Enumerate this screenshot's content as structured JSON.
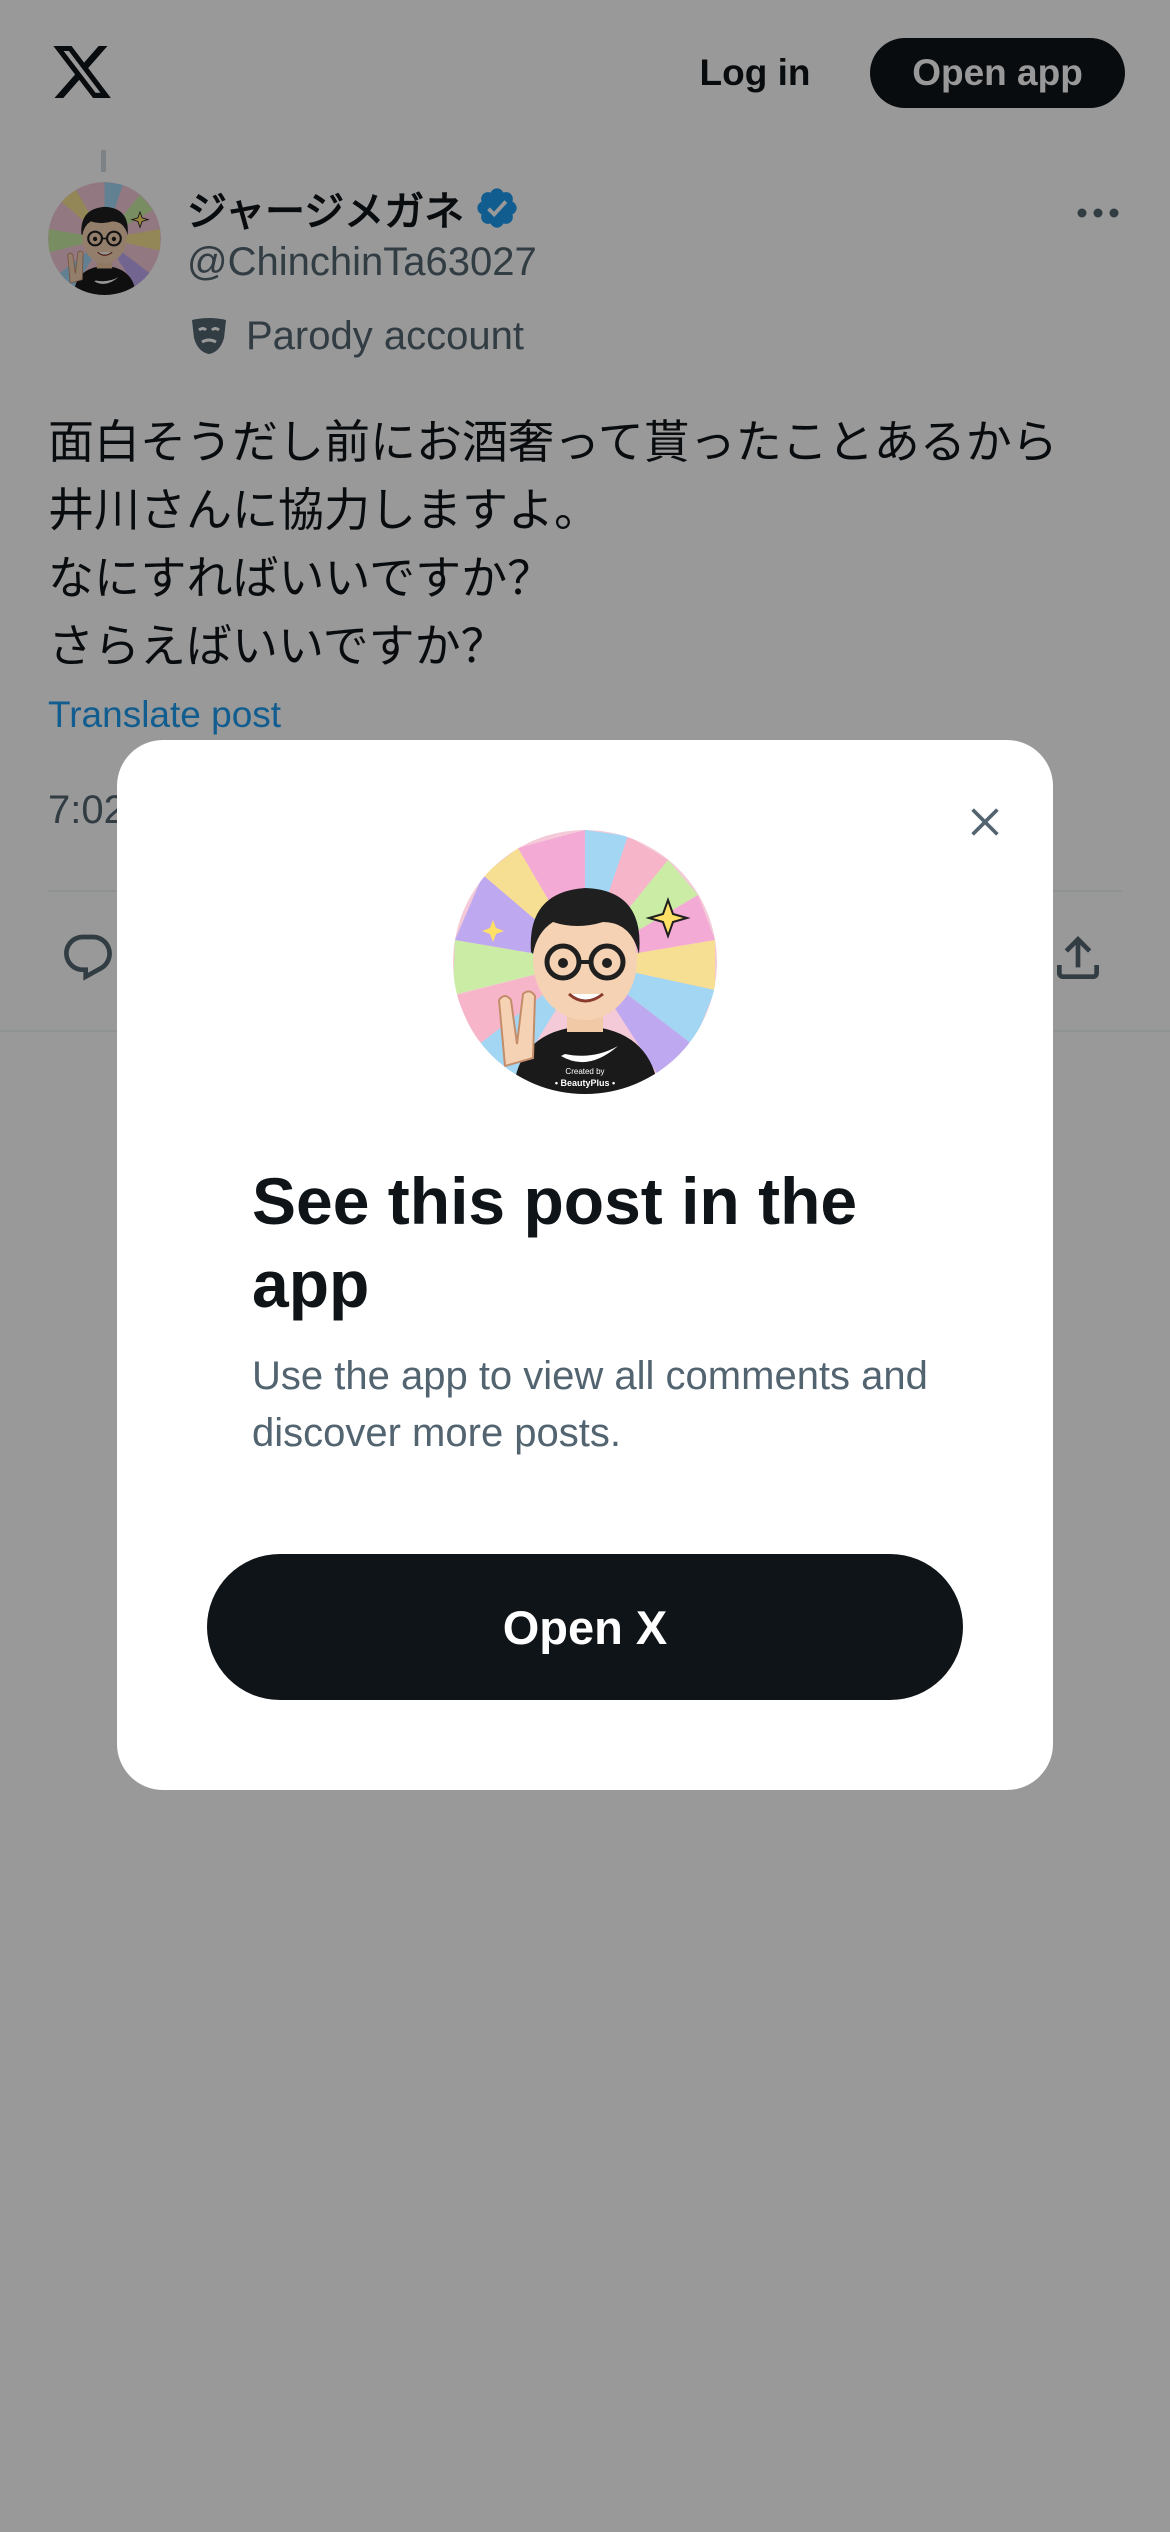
{
  "topbar": {
    "logo_icon": "x-logo-icon",
    "login_label": "Log in",
    "open_app_label": "Open app"
  },
  "post": {
    "display_name": "ジャージメガネ",
    "verified_icon": "verified-badge-icon",
    "handle": "@ChinchinTa63027",
    "parody_icon": "theater-mask-icon",
    "parody_label": "Parody account",
    "more_icon": "more-dots-icon",
    "text_lines": [
      "面白そうだし前にお酒奢って貰ったことあるから",
      "井川さんに協力しますよ。",
      "なにすればいいですか？",
      "さらえばいいですか？"
    ],
    "translate_label": "Translate post",
    "timestamp_visible": "7:02",
    "reply_icon": "reply-icon",
    "share_icon": "share-icon"
  },
  "modal": {
    "close_icon": "close-icon",
    "title": "See this post in the app",
    "subtitle": "Use the app to view all comments and discover more posts.",
    "button_label": "Open X",
    "avatar_caption_1": "Created by",
    "avatar_caption_2": "• BeautyPlus •"
  },
  "colors": {
    "accent": "#1d9bf0",
    "text_primary": "#0f1419",
    "text_secondary": "#536471",
    "button_dark": "#0f1419",
    "overlay": "rgba(0,0,0,0.4)"
  }
}
